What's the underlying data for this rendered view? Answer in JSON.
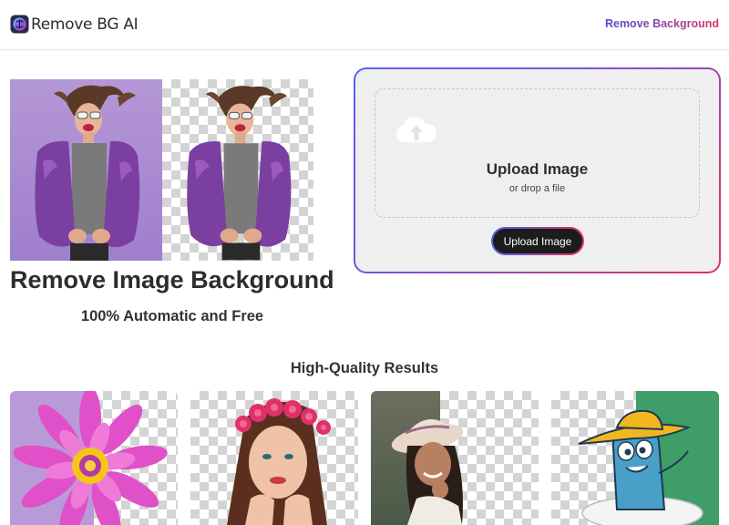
{
  "header": {
    "brand": "Remove BG AI",
    "nav_link": "Remove Background"
  },
  "hero": {
    "title": "Remove Image Background",
    "subtitle": "100% Automatic and Free",
    "image_alt_before": "original photo",
    "image_alt_after": "background removed"
  },
  "upload": {
    "title": "Upload Image",
    "subtitle": "or drop a file",
    "button": "Upload Image"
  },
  "results": {
    "title": "High-Quality Results",
    "items": [
      {
        "subject": "flower"
      },
      {
        "subject": "woman-with-flower-crown"
      },
      {
        "subject": "woman-with-hat"
      },
      {
        "subject": "cartoon-character"
      }
    ]
  },
  "colors": {
    "accent_start": "#4a4fd8",
    "accent_end": "#d6336c",
    "purple_bg": "#b497d6",
    "green_bg": "#3f9d68"
  }
}
